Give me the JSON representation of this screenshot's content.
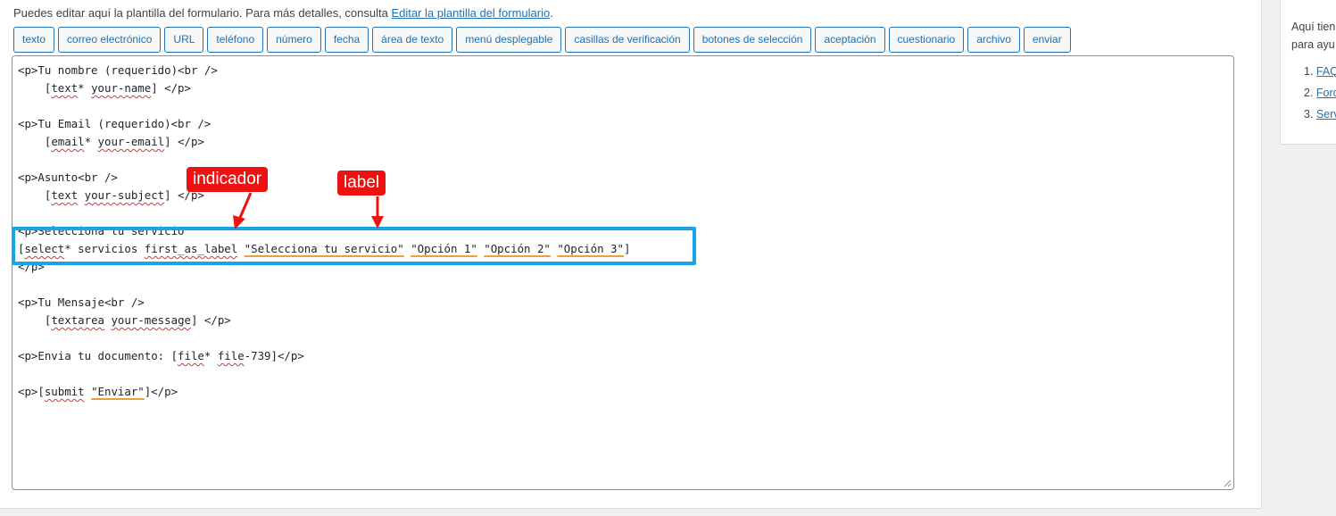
{
  "intro": {
    "text": "Puedes editar aquí la plantilla del formulario. Para más detalles, consulta ",
    "link": "Editar la plantilla del formulario",
    "suffix": "."
  },
  "tag_buttons": [
    "texto",
    "correo electrónico",
    "URL",
    "teléfono",
    "número",
    "fecha",
    "área de texto",
    "menú desplegable",
    "casillas de verificación",
    "botones de selección",
    "aceptación",
    "cuestionario",
    "archivo",
    "enviar"
  ],
  "editor": {
    "lines": [
      "<p>Tu nombre (requerido)<br />",
      "    [text* your-name] </p>",
      "",
      "<p>Tu Email (requerido)<br />",
      "    [email* your-email] </p>",
      "",
      "<p>Asunto<br />",
      "    [text your-subject] </p>",
      "",
      "<p>Selecciona tu servicio",
      "[select* servicios first_as_label \"Selecciona tu servicio\" \"Opción 1\" \"Opción 2\" \"Opción 3\"]",
      "</p>",
      "",
      "<p>Tu Mensaje<br />",
      "    [textarea your-message] </p>",
      "",
      "<p>Envia tu documento: [file* file-739]</p>",
      "",
      "<p>[submit \"Enviar\"]</p>"
    ]
  },
  "annotations": {
    "indicator": "indicador",
    "label": "label",
    "highlight_color": "#1aa3e8",
    "callout_color": "#ee1111"
  },
  "sidebar": {
    "text_line1": "Aquí tien",
    "text_line2": "para ayu",
    "items": [
      {
        "num": "1.",
        "label": "FAQ"
      },
      {
        "num": "2.",
        "label": "Foro"
      },
      {
        "num": "3.",
        "label": "Serv"
      }
    ]
  }
}
